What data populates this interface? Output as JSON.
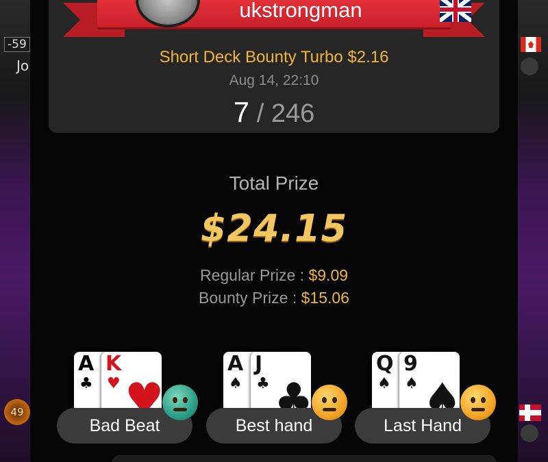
{
  "background": {
    "left_stack": "-59",
    "left_name": "Jo",
    "left_chip": "49",
    "icons": [
      "canada-flag-icon",
      "norway-flag-icon",
      "mic-icon"
    ]
  },
  "player": {
    "username": "ukstrongman",
    "flag": "uk-flag-icon"
  },
  "tournament": {
    "name": "Short Deck Bounty Turbo $2.16",
    "date": "Aug 14, 22:10",
    "position": "7",
    "separator": "/",
    "total_players": "246"
  },
  "prize": {
    "total_label": "Total Prize",
    "total_amount": "$24.15",
    "regular_label": "Regular Prize :",
    "regular_value": "$9.09",
    "bounty_label": "Bounty Prize :",
    "bounty_value": "$15.06"
  },
  "hands": [
    {
      "label": "Bad Beat",
      "emoji": "crying-face-icon",
      "cards": [
        {
          "rank": "A",
          "suit": "♣",
          "color": "#111111"
        },
        {
          "rank": "K",
          "suit": "♥",
          "color": "#d4141c"
        }
      ]
    },
    {
      "label": "Best hand",
      "emoji": "thinking-face-icon",
      "cards": [
        {
          "rank": "A",
          "suit": "♠",
          "color": "#111111"
        },
        {
          "rank": "J",
          "suit": "♣",
          "color": "#111111"
        }
      ]
    },
    {
      "label": "Last Hand",
      "emoji": "worried-face-icon",
      "cards": [
        {
          "rank": "Q",
          "suit": "♠",
          "color": "#111111"
        },
        {
          "rank": "9",
          "suit": "♠",
          "color": "#111111"
        }
      ]
    }
  ],
  "colors": {
    "accent_gold": "#f0b63a",
    "ribbon_red": "#c8202a",
    "card_bg": "#262626"
  }
}
